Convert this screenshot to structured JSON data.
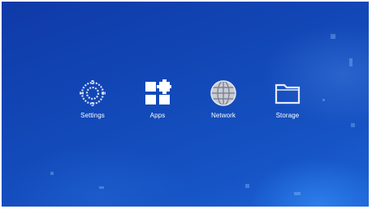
{
  "menu": {
    "items": [
      {
        "label": "Settings",
        "icon": "gear-icon"
      },
      {
        "label": "Apps",
        "icon": "apps-grid-icon"
      },
      {
        "label": "Network",
        "icon": "globe-icon"
      },
      {
        "label": "Storage",
        "icon": "folder-icon"
      }
    ]
  },
  "colors": {
    "background_top": "#0f3aa8",
    "background_bottom": "#1b63d6",
    "text": "#ffffff"
  }
}
